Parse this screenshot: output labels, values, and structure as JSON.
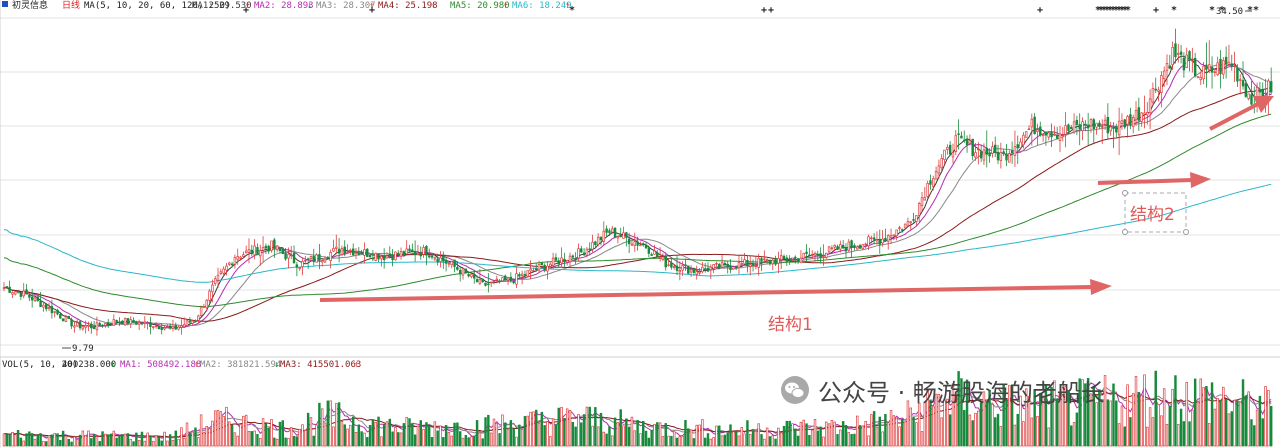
{
  "header": {
    "stock_name": "初灵信息",
    "period": "日线",
    "ma_spec": "MA(5, 10, 20, 60, 120, 250)",
    "ma_items": [
      {
        "label": "MA1: 29.530",
        "arrow": "↑",
        "color": "#3a3a3a"
      },
      {
        "label": "MA2: 28.893",
        "arrow": "↓",
        "color": "#b52bb5"
      },
      {
        "label": "MA3: 28.307",
        "arrow": "↑",
        "color": "#888888"
      },
      {
        "label": "MA4: 25.198",
        "arrow": "↑",
        "color": "#8b1a1a"
      },
      {
        "label": "MA5: 20.980",
        "arrow": "↑",
        "color": "#2e8b2e"
      },
      {
        "label": "MA6: 18.249",
        "arrow": "↑",
        "color": "#2ab7c9"
      }
    ]
  },
  "volume_header": {
    "spec": "VOL(5, 10, 20)",
    "value": "400238.000",
    "value_arrow": "↓",
    "items": [
      {
        "label": "MA1: 508492.188",
        "arrow": "↑",
        "color": "#b52bb5"
      },
      {
        "label": "MA2: 381821.594",
        "arrow": "↓",
        "color": "#888888"
      },
      {
        "label": "MA3: 415501.063",
        "arrow": "↑",
        "color": "#8b1a1a"
      }
    ]
  },
  "annotations": {
    "low_price": "9.79",
    "high_price": "34.50",
    "structure1": "结构1",
    "structure2": "结构2"
  },
  "watermark": {
    "text": "公众号 · 畅游股海的老船长"
  },
  "colors": {
    "up": "#e03c3c",
    "down": "#178a3c",
    "arrow": "#e06666",
    "ma5": "#3a3a3a",
    "ma10": "#b52bb5",
    "ma20": "#888888",
    "ma60": "#8b1a1a",
    "ma120": "#2e8b2e",
    "ma250": "#2ab7c9"
  },
  "chart_data": {
    "type": "candlestick",
    "ylim": [
      8,
      36
    ],
    "price_waypoints": [
      [
        0,
        13.6
      ],
      [
        8,
        13.0
      ],
      [
        18,
        11.6
      ],
      [
        25,
        10.5
      ],
      [
        32,
        10.4
      ],
      [
        40,
        10.9
      ],
      [
        52,
        10.6
      ],
      [
        60,
        10.2
      ],
      [
        68,
        11.0
      ],
      [
        75,
        14.0
      ],
      [
        82,
        16.2
      ],
      [
        95,
        17.0
      ],
      [
        105,
        15.5
      ],
      [
        120,
        16.8
      ],
      [
        135,
        16.2
      ],
      [
        150,
        16.6
      ],
      [
        160,
        15.3
      ],
      [
        170,
        13.8
      ],
      [
        180,
        14.2
      ],
      [
        190,
        15.2
      ],
      [
        205,
        16.5
      ],
      [
        215,
        18.2
      ],
      [
        228,
        17.0
      ],
      [
        235,
        15.6
      ],
      [
        245,
        15.0
      ],
      [
        255,
        15.3
      ],
      [
        265,
        15.6
      ],
      [
        278,
        15.9
      ],
      [
        290,
        16.4
      ],
      [
        300,
        17.0
      ],
      [
        312,
        17.6
      ],
      [
        322,
        19.0
      ],
      [
        330,
        23.0
      ],
      [
        338,
        25.6
      ],
      [
        346,
        24.8
      ],
      [
        355,
        24.4
      ],
      [
        365,
        26.8
      ],
      [
        375,
        26.3
      ],
      [
        385,
        27.0
      ],
      [
        395,
        26.7
      ],
      [
        405,
        28.2
      ],
      [
        415,
        32.8
      ],
      [
        425,
        31.0
      ],
      [
        436,
        32.0
      ],
      [
        443,
        29.0
      ],
      [
        450,
        30.0
      ]
    ],
    "volume_ylim": [
      0,
      1200000
    ],
    "volume_waypoints": [
      [
        0,
        180000
      ],
      [
        60,
        150000
      ],
      [
        75,
        420000
      ],
      [
        100,
        280000
      ],
      [
        115,
        480000
      ],
      [
        140,
        300000
      ],
      [
        170,
        320000
      ],
      [
        205,
        460000
      ],
      [
        230,
        300000
      ],
      [
        260,
        260000
      ],
      [
        300,
        320000
      ],
      [
        320,
        450000
      ],
      [
        335,
        800000
      ],
      [
        360,
        650000
      ],
      [
        385,
        700000
      ],
      [
        410,
        850000
      ],
      [
        430,
        780000
      ],
      [
        450,
        600000
      ]
    ],
    "moving_averages": [
      5,
      10,
      20,
      60,
      120,
      250
    ]
  }
}
